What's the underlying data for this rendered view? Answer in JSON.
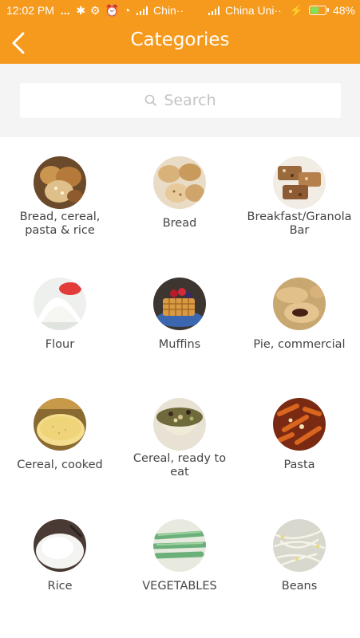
{
  "status_bar": {
    "time": "12:02 PM",
    "dots": "...",
    "carrier1": "Chin··",
    "carrier2": "China Uni··",
    "battery": "48%"
  },
  "header": {
    "title": "Categories",
    "back_icon": "chevron-left-icon"
  },
  "search": {
    "placeholder": "Search",
    "icon": "search-icon"
  },
  "colors": {
    "accent": "#f59a1d",
    "search_bg": "#f4f4f4",
    "label_text": "#444444"
  },
  "categories": [
    {
      "label": "Bread, cereal, pasta & rice"
    },
    {
      "label": "Bread"
    },
    {
      "label": "Breakfast/Granola Bar"
    },
    {
      "label": "Flour"
    },
    {
      "label": "Muffins"
    },
    {
      "label": "Pie, commercial"
    },
    {
      "label": "Cereal, cooked"
    },
    {
      "label": "Cereal, ready to eat"
    },
    {
      "label": "Pasta"
    },
    {
      "label": "Rice"
    },
    {
      "label": "VEGETABLES"
    },
    {
      "label": "Beans"
    }
  ]
}
